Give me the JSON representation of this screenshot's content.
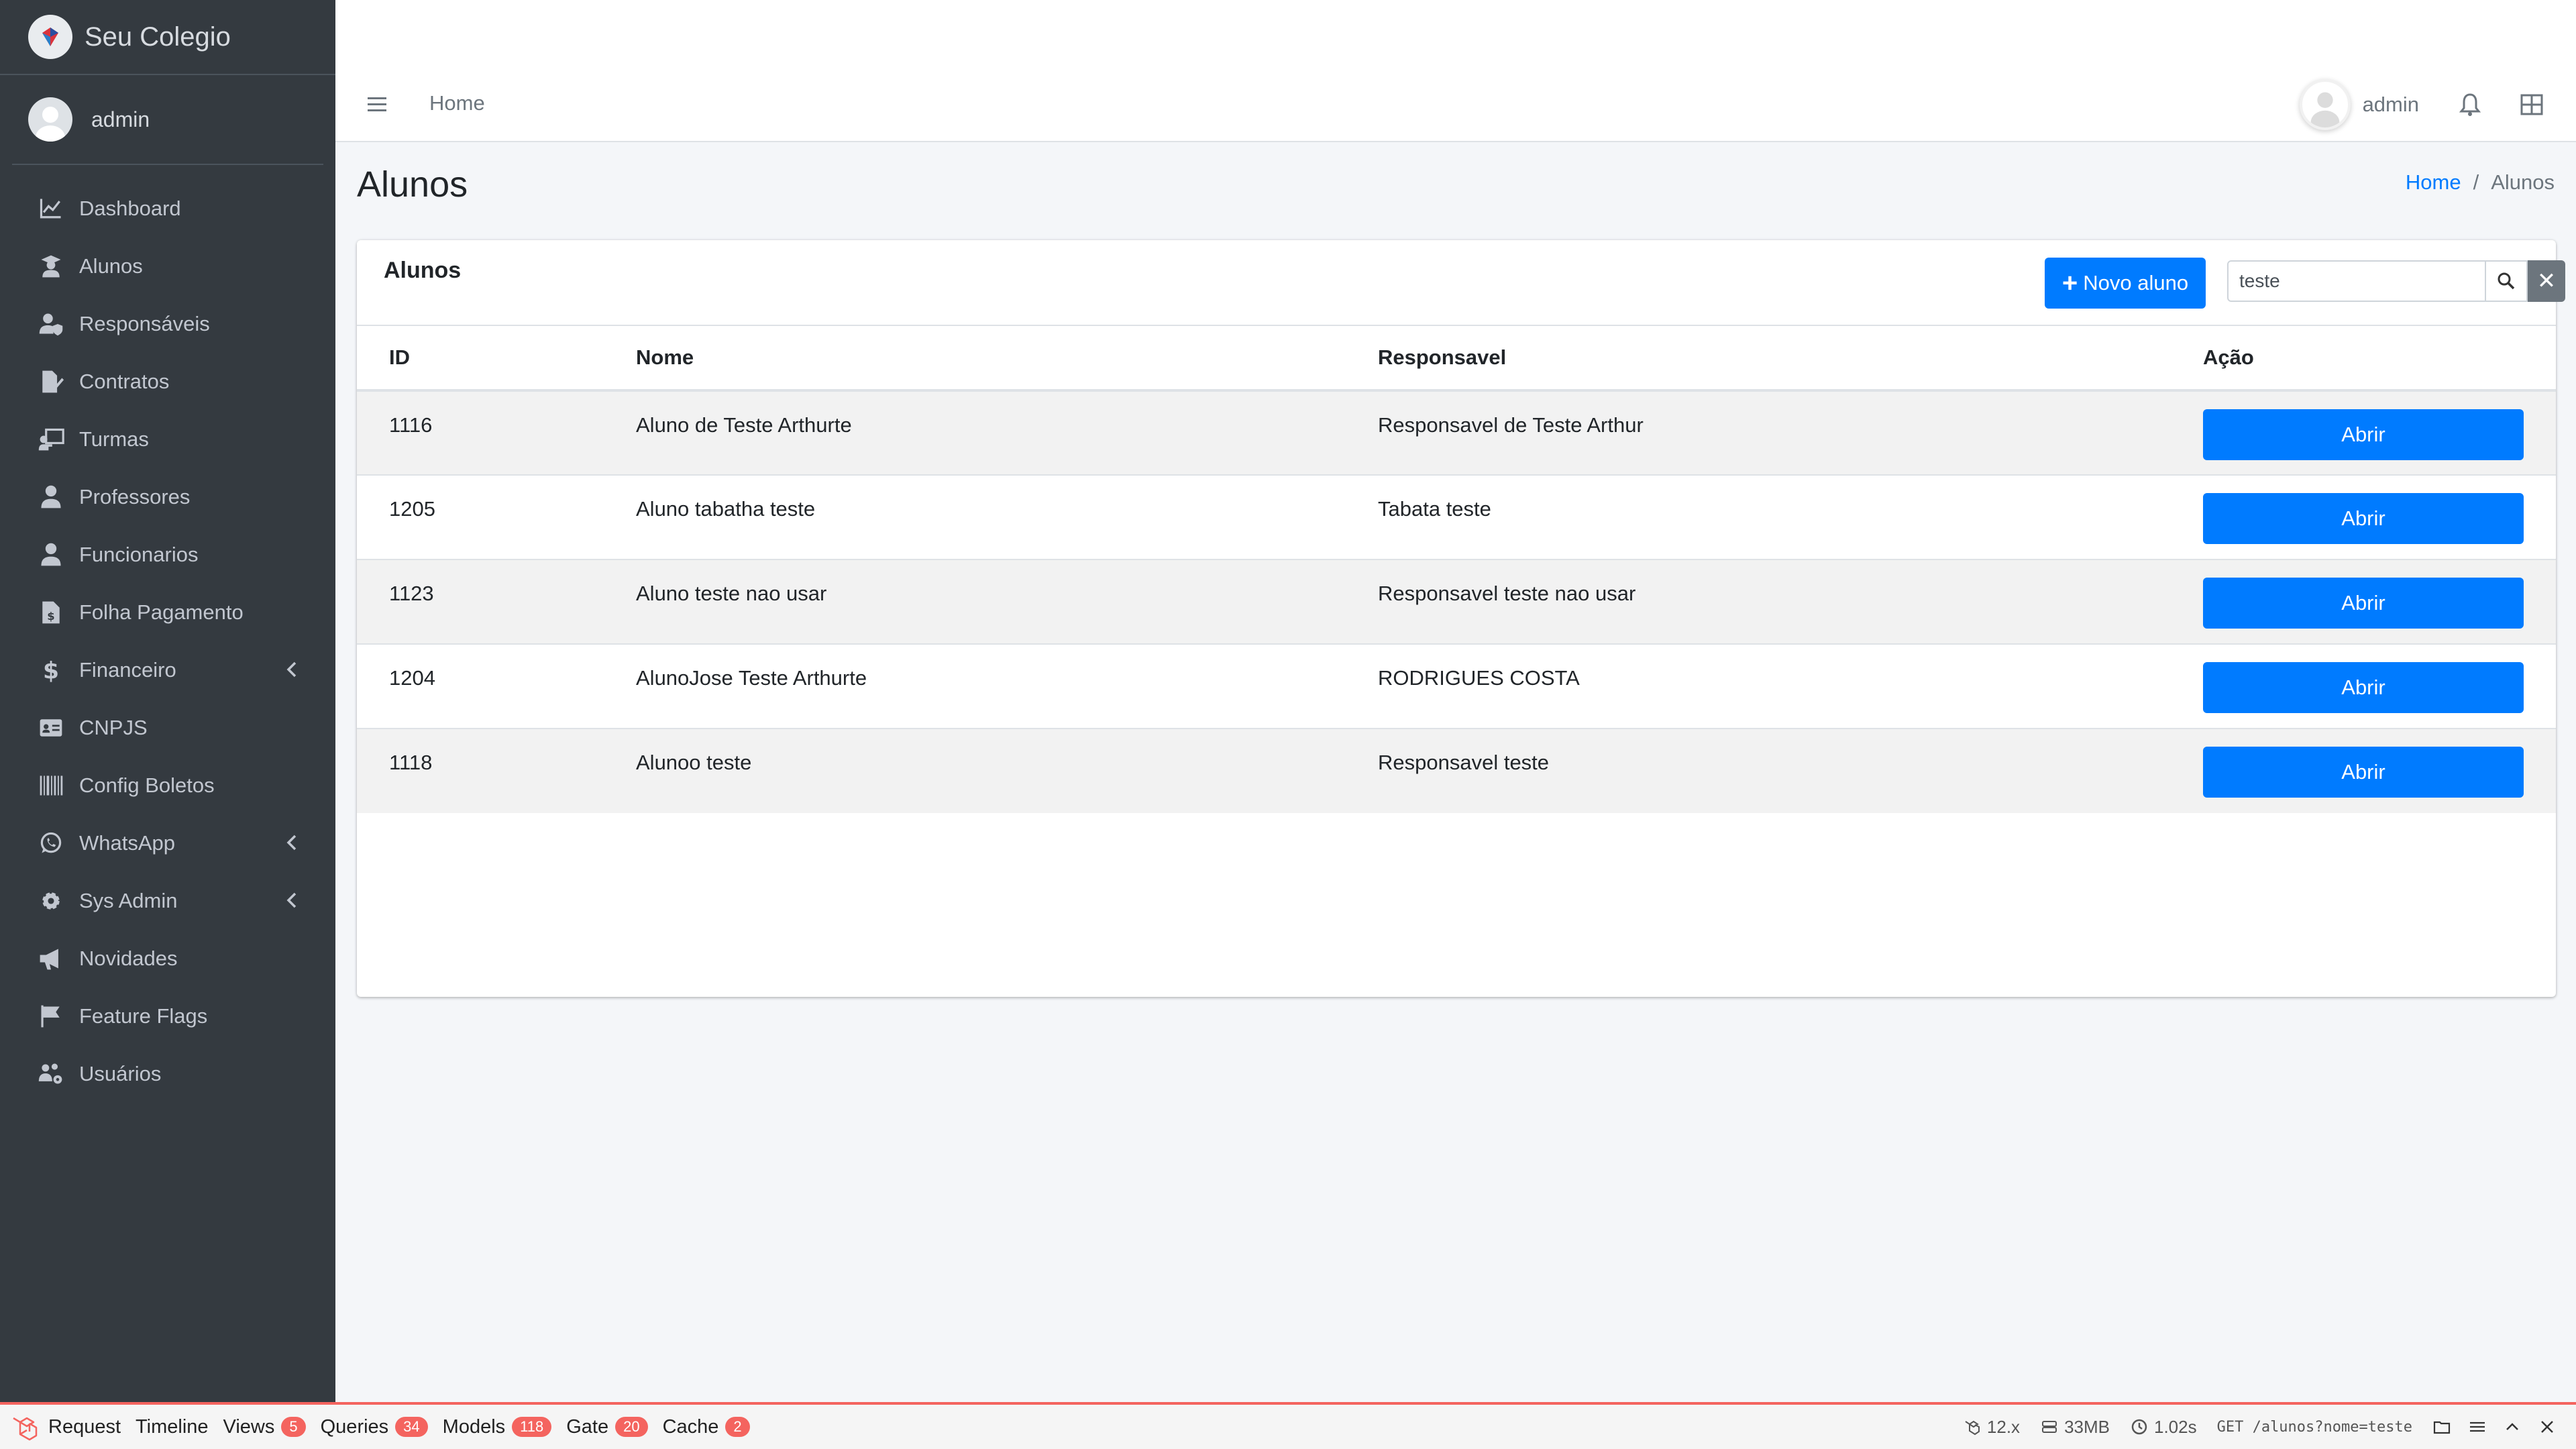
{
  "brand": {
    "name": "Seu Colegio"
  },
  "sidebar_user": {
    "name": "admin"
  },
  "nav": [
    {
      "label": "Dashboard",
      "icon": "chart-line-icon",
      "chevron": false
    },
    {
      "label": "Alunos",
      "icon": "user-graduate-icon",
      "chevron": false
    },
    {
      "label": "Responsáveis",
      "icon": "user-shield-icon",
      "chevron": false
    },
    {
      "label": "Contratos",
      "icon": "file-signature-icon",
      "chevron": false
    },
    {
      "label": "Turmas",
      "icon": "chalkboard-teacher-icon",
      "chevron": false
    },
    {
      "label": "Professores",
      "icon": "user-tie-icon",
      "chevron": false
    },
    {
      "label": "Funcionarios",
      "icon": "user-tie-icon",
      "chevron": false
    },
    {
      "label": "Folha Pagamento",
      "icon": "file-invoice-dollar-icon",
      "chevron": false
    },
    {
      "label": "Financeiro",
      "icon": "dollar-sign-icon",
      "chevron": true
    },
    {
      "label": "CNPJS",
      "icon": "id-card-icon",
      "chevron": false
    },
    {
      "label": "Config Boletos",
      "icon": "barcode-icon",
      "chevron": false
    },
    {
      "label": "WhatsApp",
      "icon": "whatsapp-icon",
      "chevron": true
    },
    {
      "label": "Sys Admin",
      "icon": "cog-icon",
      "chevron": true
    },
    {
      "label": "Novidades",
      "icon": "bullhorn-icon",
      "chevron": false
    },
    {
      "label": "Feature Flags",
      "icon": "flag-icon",
      "chevron": false
    },
    {
      "label": "Usuários",
      "icon": "users-cog-icon",
      "chevron": false
    }
  ],
  "topbar": {
    "home_link": "Home",
    "user_name": "admin"
  },
  "page": {
    "title": "Alunos",
    "breadcrumb": {
      "home": "Home",
      "separator": "/",
      "current": "Alunos"
    }
  },
  "card": {
    "title": "Alunos",
    "new_button": "Novo aluno",
    "search": {
      "value": "teste",
      "placeholder": ""
    },
    "clear_symbol": "✕"
  },
  "table": {
    "headers": {
      "id": "ID",
      "nome": "Nome",
      "responsavel": "Responsavel",
      "acao": "Ação"
    },
    "rows": [
      {
        "id": "1116",
        "nome": "Aluno de Teste Arthurte",
        "responsavel": "Responsavel de Teste Arthur",
        "action": "Abrir"
      },
      {
        "id": "1205",
        "nome": "Aluno tabatha teste",
        "responsavel": "Tabata teste",
        "action": "Abrir"
      },
      {
        "id": "1123",
        "nome": "Aluno teste nao usar",
        "responsavel": "Responsavel teste nao usar",
        "action": "Abrir"
      },
      {
        "id": "1204",
        "nome": "AlunoJose Teste Arthurte",
        "responsavel": "RODRIGUES COSTA",
        "action": "Abrir"
      },
      {
        "id": "1118",
        "nome": "Alunoo teste",
        "responsavel": "Responsavel teste",
        "action": "Abrir"
      }
    ]
  },
  "debugbar": {
    "tabs": [
      {
        "label": "Request",
        "badge": null
      },
      {
        "label": "Timeline",
        "badge": null
      },
      {
        "label": "Views",
        "badge": "5"
      },
      {
        "label": "Queries",
        "badge": "34"
      },
      {
        "label": "Models",
        "badge": "118"
      },
      {
        "label": "Gate",
        "badge": "20"
      },
      {
        "label": "Cache",
        "badge": "2"
      }
    ],
    "version": "12.x",
    "memory": "33MB",
    "duration": "1.02s",
    "route": "GET /alunos?nome=teste"
  },
  "colors": {
    "sidebar_bg": "#343a40",
    "primary": "#007bff",
    "debug_accent": "#f4645f",
    "clear_button": "#6c757d"
  }
}
